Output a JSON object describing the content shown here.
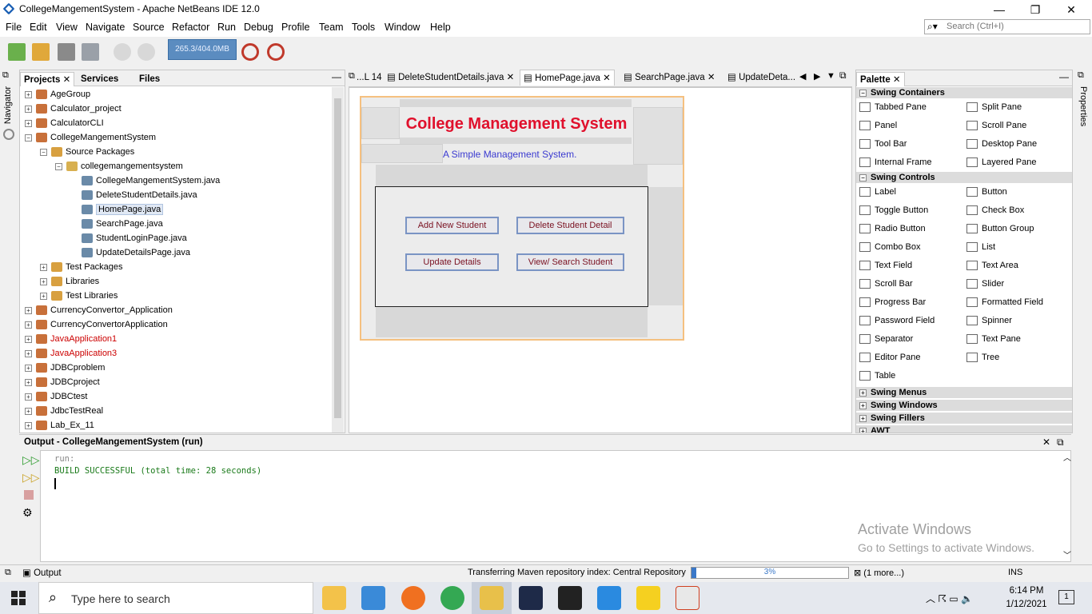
{
  "window": {
    "title": "CollegeMangementSystem - Apache NetBeans IDE 12.0",
    "minimize": "—",
    "restore": "❐",
    "close": "✕"
  },
  "menu": [
    "File",
    "Edit",
    "View",
    "Navigate",
    "Source",
    "Refactor",
    "Run",
    "Debug",
    "Profile",
    "Team",
    "Tools",
    "Window",
    "Help"
  ],
  "search": {
    "placeholder": "Search (Ctrl+I)"
  },
  "toolbar": {
    "memory": "265.3/404.0MB"
  },
  "left_panel": {
    "tabs": [
      "Projects",
      "Services",
      "Files"
    ],
    "navigator": "Navigator",
    "tree": [
      {
        "label": "AgeGroup",
        "level": 0,
        "exp": "+",
        "type": "project"
      },
      {
        "label": "Calculator_project",
        "level": 0,
        "exp": "+",
        "type": "project"
      },
      {
        "label": "CalculatorCLI",
        "level": 0,
        "exp": "+",
        "type": "project"
      },
      {
        "label": "CollegeMangementSystem",
        "level": 0,
        "exp": "−",
        "type": "project"
      },
      {
        "label": "Source Packages",
        "level": 1,
        "exp": "−",
        "type": "folder"
      },
      {
        "label": "collegemangementsystem",
        "level": 2,
        "exp": "−",
        "type": "package"
      },
      {
        "label": "CollegeMangementSystem.java",
        "level": 3,
        "exp": "",
        "type": "java"
      },
      {
        "label": "DeleteStudentDetails.java",
        "level": 3,
        "exp": "",
        "type": "java"
      },
      {
        "label": "HomePage.java",
        "level": 3,
        "exp": "",
        "type": "java",
        "selected": true
      },
      {
        "label": "SearchPage.java",
        "level": 3,
        "exp": "",
        "type": "java"
      },
      {
        "label": "StudentLoginPage.java",
        "level": 3,
        "exp": "",
        "type": "java"
      },
      {
        "label": "UpdateDetailsPage.java",
        "level": 3,
        "exp": "",
        "type": "java"
      },
      {
        "label": "Test Packages",
        "level": 1,
        "exp": "+",
        "type": "folder"
      },
      {
        "label": "Libraries",
        "level": 1,
        "exp": "+",
        "type": "folder"
      },
      {
        "label": "Test Libraries",
        "level": 1,
        "exp": "+",
        "type": "folder"
      },
      {
        "label": "CurrencyConvertor_Application",
        "level": 0,
        "exp": "+",
        "type": "project"
      },
      {
        "label": "CurrencyConvertorApplication",
        "level": 0,
        "exp": "+",
        "type": "project"
      },
      {
        "label": "JavaApplication1",
        "level": 0,
        "exp": "+",
        "type": "project",
        "error": true
      },
      {
        "label": "JavaApplication3",
        "level": 0,
        "exp": "+",
        "type": "project",
        "error": true
      },
      {
        "label": "JDBCproblem",
        "level": 0,
        "exp": "+",
        "type": "project"
      },
      {
        "label": "JDBCproject",
        "level": 0,
        "exp": "+",
        "type": "project"
      },
      {
        "label": "JDBCtest",
        "level": 0,
        "exp": "+",
        "type": "project"
      },
      {
        "label": "JdbcTestReal",
        "level": 0,
        "exp": "+",
        "type": "project"
      },
      {
        "label": "Lab_Ex_11",
        "level": 0,
        "exp": "+",
        "type": "project"
      }
    ]
  },
  "editor": {
    "tabs": [
      "...L 14",
      "DeleteStudentDetails.java",
      "HomePage.java",
      "SearchPage.java",
      "UpdateDeta..."
    ],
    "design": {
      "heading": "College Management System",
      "subtitle": "A Simple Management System.",
      "buttons": [
        "Add New Student",
        "Delete Student Detail",
        "Update Details",
        "View/ Search Student"
      ]
    }
  },
  "palette": {
    "title": "Palette",
    "properties": "Properties",
    "sections": [
      {
        "name": "Swing Containers",
        "items": [
          "Tabbed Pane",
          "Split Pane",
          "Panel",
          "Scroll Pane",
          "Tool Bar",
          "Desktop Pane",
          "Internal Frame",
          "Layered Pane"
        ]
      },
      {
        "name": "Swing Controls",
        "items": [
          "Label",
          "Button",
          "Toggle Button",
          "Check Box",
          "Radio Button",
          "Button Group",
          "Combo Box",
          "List",
          "Text Field",
          "Text Area",
          "Scroll Bar",
          "Slider",
          "Progress Bar",
          "Formatted Field",
          "Password Field",
          "Spinner",
          "Separator",
          "Text Pane",
          "Editor Pane",
          "Tree",
          "Table"
        ]
      }
    ],
    "collapsed": [
      "Swing Menus",
      "Swing Windows",
      "Swing Fillers",
      "AWT"
    ]
  },
  "output": {
    "title": "Output - CollegeMangementSystem (run)",
    "lines": [
      "run:",
      "BUILD SUCCESSFUL (total time: 28 seconds)"
    ]
  },
  "watermark": {
    "line1": "Activate Windows",
    "line2": "Go to Settings to activate Windows."
  },
  "status": {
    "output_tab": "Output",
    "task": "Transferring Maven repository index: Central Repository",
    "progress_label": "3%",
    "progress": 0.03,
    "more": "(1 more...)",
    "mode": "INS"
  },
  "taskbar": {
    "search_placeholder": "Type here to search",
    "time": "6:14 PM",
    "date": "1/12/2021",
    "notifications": "1"
  }
}
